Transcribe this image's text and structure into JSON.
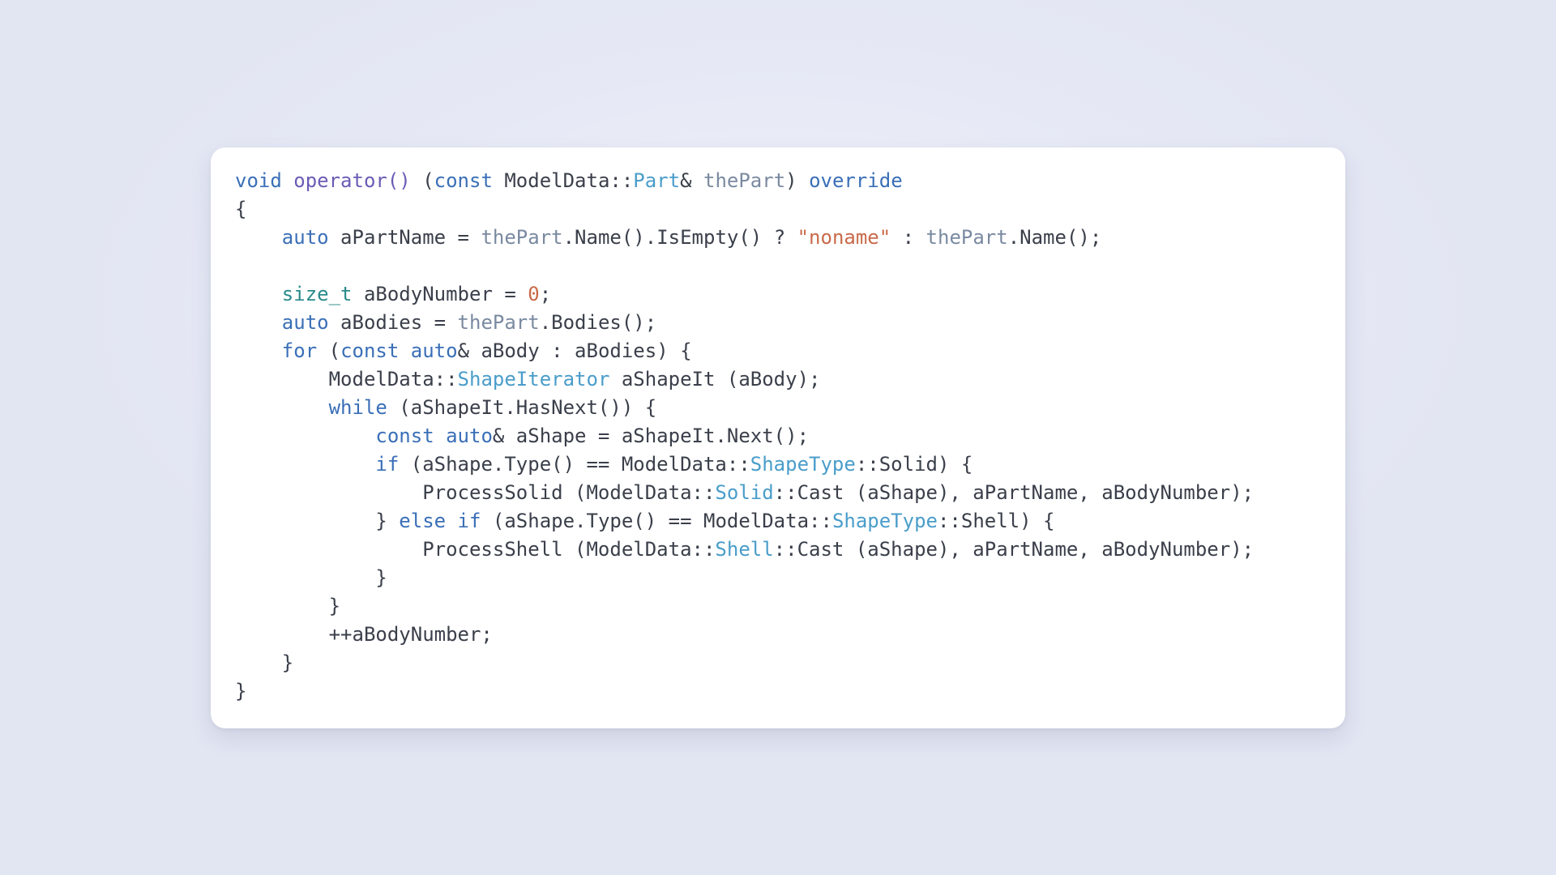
{
  "colors": {
    "background": "#e6e9f5",
    "card": "#ffffff",
    "text": "#3a3f4a",
    "keyword": "#3a6fb7",
    "type": "#2a8a8a",
    "function": "#6b5bb5",
    "class": "#4a9dca",
    "param": "#7a8aa0",
    "string": "#c96a4a"
  },
  "code": {
    "language": "cpp",
    "tokens": {
      "l1": {
        "kw_void": "void",
        "fn_op": "operator()",
        "p_open": " (",
        "kw_const": "const",
        "ns": " ModelData::",
        "cls_part": "Part",
        "amp": "& ",
        "var_thePart": "thePart",
        "p_close": ") ",
        "kw_override": "override"
      },
      "l2": {
        "brace": "{"
      },
      "l3": {
        "indent": "    ",
        "kw_auto": "auto",
        "sp": " ",
        "id_aPartName": "aPartName",
        "eq": " = ",
        "var_thePart": "thePart",
        "call1": ".Name().IsEmpty() ? ",
        "str": "\"noname\"",
        "colon": " : ",
        "var_thePart2": "thePart",
        "call2": ".Name();"
      },
      "l4": {
        "blank": ""
      },
      "l5": {
        "indent": "    ",
        "ty_sizet": "size_t",
        "sp": " ",
        "id_aBodyNumber": "aBodyNumber = ",
        "num_zero": "0",
        "semi": ";"
      },
      "l6": {
        "indent": "    ",
        "kw_auto": "auto",
        "sp": " ",
        "id_aBodies": "aBodies = ",
        "var_thePart": "thePart",
        "call": ".Bodies();"
      },
      "l7": {
        "indent": "    ",
        "kw_for": "for",
        "p_open": " (",
        "kw_const": "const",
        "sp": " ",
        "kw_auto": "auto",
        "amp": "& aBody : aBodies) {"
      },
      "l8": {
        "indent": "        ",
        "ns": "ModelData::",
        "cls_iter": "ShapeIterator",
        "rest": " aShapeIt (aBody);"
      },
      "l9": {
        "indent": "        ",
        "kw_while": "while",
        "rest": " (aShapeIt.HasNext()) {"
      },
      "l10": {
        "indent": "            ",
        "kw_const": "const",
        "sp": " ",
        "kw_auto": "auto",
        "rest": "& aShape = aShapeIt.Next();"
      },
      "l11": {
        "indent": "            ",
        "kw_if": "if",
        "p_open": " (aShape.Type() == ModelData::",
        "cls_st": "ShapeType",
        "rest": "::Solid) {"
      },
      "l12": {
        "indent": "                ",
        "call": "ProcessSolid (ModelData::",
        "cls_solid": "Solid",
        "rest": "::Cast (aShape), aPartName, aBodyNumber);"
      },
      "l13": {
        "indent": "            ",
        "brace": "} ",
        "kw_else": "else",
        "sp": " ",
        "kw_if": "if",
        "p_open": " (aShape.Type() == ModelData::",
        "cls_st": "ShapeType",
        "rest": "::Shell) {"
      },
      "l14": {
        "indent": "                ",
        "call": "ProcessShell (ModelData::",
        "cls_shell": "Shell",
        "rest": "::Cast (aShape), aPartName, aBodyNumber);"
      },
      "l15": {
        "indent": "            ",
        "brace": "}"
      },
      "l16": {
        "indent": "        ",
        "brace": "}"
      },
      "l17": {
        "indent": "        ",
        "stmt": "++aBodyNumber;"
      },
      "l18": {
        "indent": "    ",
        "brace": "}"
      },
      "l19": {
        "brace": "}"
      }
    }
  }
}
